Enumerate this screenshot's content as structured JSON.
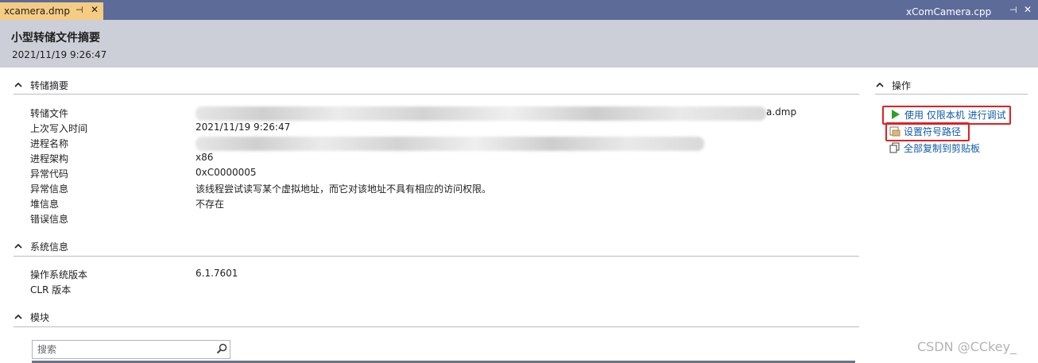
{
  "tabs": {
    "active": {
      "label": "xcamera.dmp",
      "pin": "⊣",
      "close": "✕"
    },
    "other": {
      "label": "xComCamera.cpp",
      "pin": "⊣",
      "close": "✕"
    }
  },
  "header": {
    "title": "小型转储文件摘要",
    "timestamp": "2021/11/19 9:26:47"
  },
  "sections": {
    "dump_summary": {
      "title": "转储摘要",
      "rows": [
        {
          "key": "转储文件",
          "value": "a.dmp"
        },
        {
          "key": "上次写入时间",
          "value": "2021/11/19 9:26:47"
        },
        {
          "key": "进程名称",
          "value": ""
        },
        {
          "key": "进程架构",
          "value": "x86"
        },
        {
          "key": "异常代码",
          "value": "0xC0000005"
        },
        {
          "key": "异常信息",
          "value": "该线程尝试读写某个虚拟地址，而它对该地址不具有相应的访问权限。"
        },
        {
          "key": "堆信息",
          "value": "不存在"
        },
        {
          "key": "错误信息",
          "value": ""
        }
      ]
    },
    "system_info": {
      "title": "系统信息",
      "rows": [
        {
          "key": "操作系统版本",
          "value": "6.1.7601"
        },
        {
          "key": "CLR 版本",
          "value": ""
        }
      ]
    },
    "modules": {
      "title": "模块",
      "search_placeholder": "搜索"
    },
    "actions": {
      "title": "操作",
      "items": [
        {
          "label": "使用 仅限本机 进行调试",
          "icon": "play-icon"
        },
        {
          "label": "设置符号路径",
          "icon": "folder-icon"
        },
        {
          "label": "全部复制到剪贴板",
          "icon": "copy-icon"
        }
      ]
    }
  },
  "watermark": "CSDN @CCkey_",
  "colors": {
    "tabbar": "#5d6b99",
    "active_tab": "#f5cc84",
    "header": "#ccced8",
    "link": "#0e5ca8",
    "highlight": "#e02020",
    "play": "#2e9e2e"
  }
}
